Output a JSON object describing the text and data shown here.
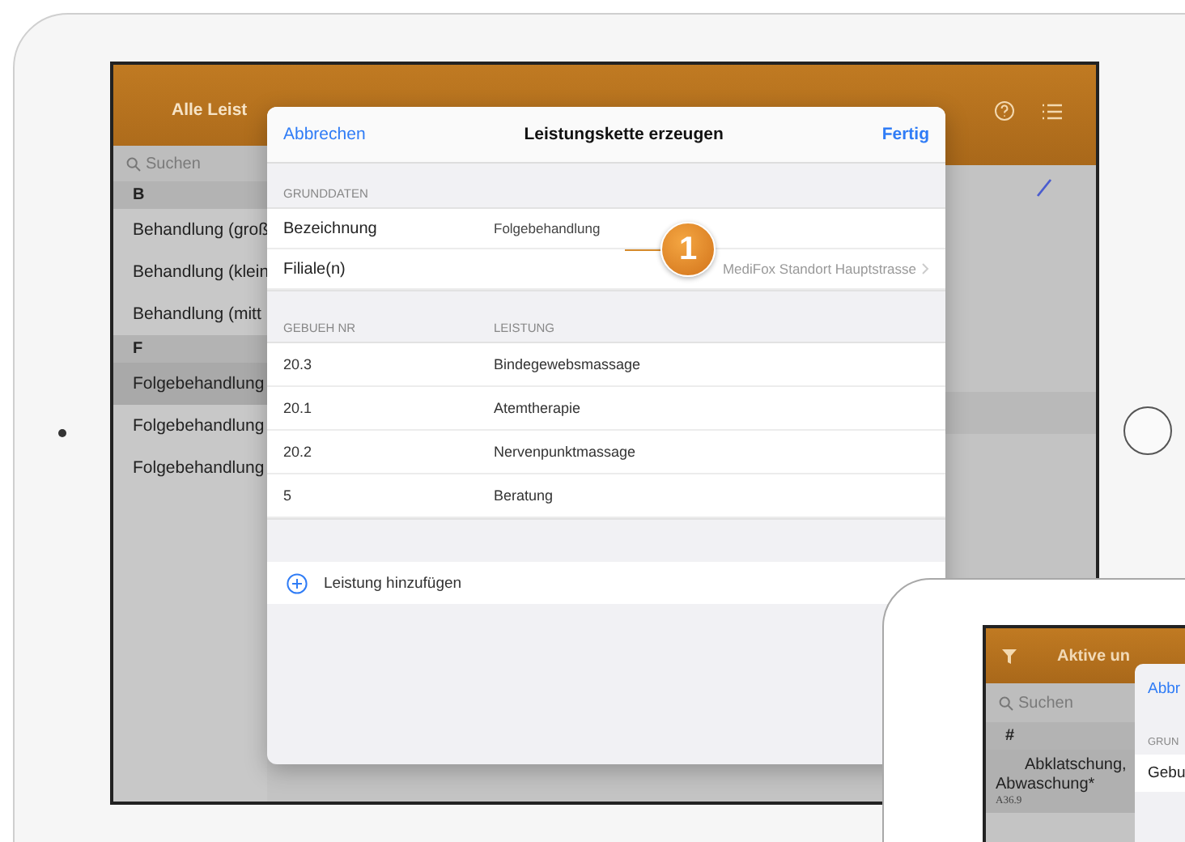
{
  "tablet": {
    "header": {
      "title": "Alle Leist"
    },
    "sidebar": {
      "search": {
        "placeholder": "Suchen"
      },
      "sections": [
        {
          "letter": "B",
          "items": [
            {
              "label": "Behandlung (groß",
              "selected": false
            },
            {
              "label": "Behandlung (klein",
              "selected": false
            },
            {
              "label": "Behandlung (mitt",
              "selected": false
            }
          ]
        },
        {
          "letter": "F",
          "items": [
            {
              "label": "Folgebehandlung",
              "selected": true
            },
            {
              "label": "Folgebehandlung",
              "selected": false
            },
            {
              "label": "Folgebehandlung",
              "selected": false
            }
          ]
        }
      ]
    },
    "modal": {
      "cancel": "Abbrechen",
      "title": "Leistungskette erzeugen",
      "done": "Fertig",
      "section": "GRUNDDATEN",
      "fields": [
        {
          "label": "Bezeichnung",
          "value": "Folgebehandlung",
          "kind": "text"
        },
        {
          "label": "Filiale(n)",
          "value": "MediFox Standort Hauptstrasse",
          "kind": "disclosure"
        }
      ],
      "table": {
        "columns": [
          "GEBUEH NR",
          "LEISTUNG"
        ],
        "rows": [
          [
            "20.3",
            "Bindegewebsmassage"
          ],
          [
            "20.1",
            "Atemtherapie"
          ],
          [
            "20.2",
            "Nervenpunktmassage"
          ],
          [
            "5",
            "Beratung"
          ]
        ]
      },
      "add": "Leistung hinzufügen"
    },
    "callout": {
      "number": "1"
    }
  },
  "phone": {
    "header": {
      "title": "Aktive un"
    },
    "search": {
      "placeholder": "Suchen"
    },
    "section": "#",
    "item": {
      "title": "Abklatschung, Abwaschung*",
      "code": "A36.9"
    },
    "modal": {
      "cancel": "Abbr",
      "section": "GRUN",
      "field": "Gebu"
    }
  }
}
